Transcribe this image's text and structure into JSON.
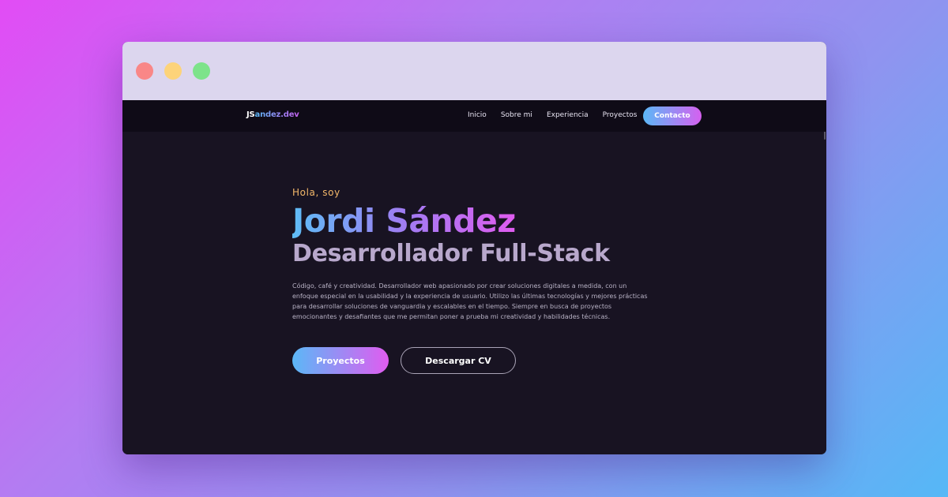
{
  "colors": {
    "background_gradient": [
      "#e24cf5",
      "#8f94f0",
      "#55b8f6"
    ],
    "page_bg": "#181322",
    "navbar_bg": "#0f0b17",
    "accent_gradient": [
      "#5bb8f7",
      "#e05cf0"
    ],
    "greeting": "#f4b86a",
    "role": "#b8a8cc"
  },
  "window": {
    "controls": [
      "close-icon",
      "minimize-icon",
      "maximize-icon"
    ]
  },
  "navbar": {
    "logo_prefix": "JS",
    "logo_suffix": "andez.dev",
    "links": [
      "Inicio",
      "Sobre mi",
      "Experiencia",
      "Proyectos"
    ],
    "cta_label": "Contacto"
  },
  "hero": {
    "greeting": "Hola, soy",
    "name": "Jordi Sández",
    "role": "Desarrollador Full-Stack",
    "bio": "Código, café y creatividad. Desarrollador web apasionado por crear soluciones digitales a medida, con un enfoque especial en la usabilidad y la experiencia de usuario. Utilizo las últimas tecnologías y mejores prácticas para desarrollar soluciones de vanguardia y escalables en el tiempo. Siempre en busca de proyectos emocionantes y desafiantes que me permitan poner a prueba mi creatividad y habilidades técnicas.",
    "primary_button": "Proyectos",
    "secondary_button": "Descargar CV"
  }
}
